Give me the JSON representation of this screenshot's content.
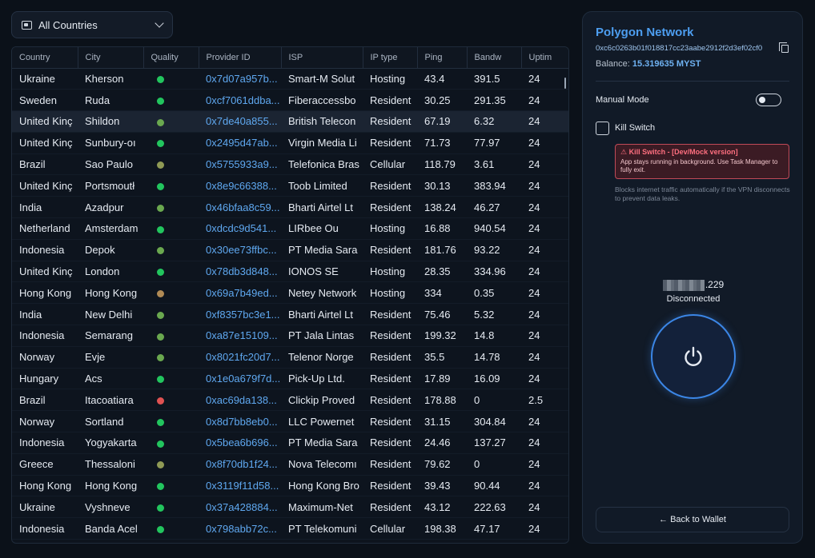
{
  "country_filter": {
    "label": "All Countries",
    "icon": "flag-icon"
  },
  "table": {
    "columns": [
      "Country",
      "City",
      "Quality",
      "Provider ID",
      "ISP",
      "IP type",
      "Ping",
      "Bandw",
      "Uptim"
    ],
    "rows": [
      {
        "country": "Ukraine",
        "city": "Kherson",
        "quality": "#22c55e",
        "provider_id": "0x7d07a957b...",
        "isp": "Smart-M Solut",
        "ip_type": "Hosting",
        "ping": "43.4",
        "bandw": "391.5",
        "uptime": "24"
      },
      {
        "country": "Sweden",
        "city": "Ruda",
        "quality": "#22c55e",
        "provider_id": "0xcf7061ddba...",
        "isp": "Fiberaccessbo",
        "ip_type": "Resident",
        "ping": "30.25",
        "bandw": "291.35",
        "uptime": "24"
      },
      {
        "country": "United Kinç",
        "city": "Shildon",
        "quality": "#6aa84f",
        "provider_id": "0x7de40a855...",
        "isp": "British Telecon",
        "ip_type": "Resident",
        "ping": "67.19",
        "bandw": "6.32",
        "uptime": "24"
      },
      {
        "country": "United Kinç",
        "city": "Sunbury-oı",
        "quality": "#22c55e",
        "provider_id": "0x2495d47ab...",
        "isp": "Virgin Media Li",
        "ip_type": "Resident",
        "ping": "71.73",
        "bandw": "77.97",
        "uptime": "24"
      },
      {
        "country": "Brazil",
        "city": "Sao Paulo",
        "quality": "#8f9a55",
        "provider_id": "0x5755933a9...",
        "isp": "Telefonica Bras",
        "ip_type": "Cellular",
        "ping": "118.79",
        "bandw": "3.61",
        "uptime": "24"
      },
      {
        "country": "United Kinç",
        "city": "Portsmoutł",
        "quality": "#22c55e",
        "provider_id": "0x8e9c66388...",
        "isp": "Toob Limited",
        "ip_type": "Resident",
        "ping": "30.13",
        "bandw": "383.94",
        "uptime": "24"
      },
      {
        "country": "India",
        "city": "Azadpur",
        "quality": "#6aa84f",
        "provider_id": "0x46bfaa8c59...",
        "isp": "Bharti Airtel Lt",
        "ip_type": "Resident",
        "ping": "138.24",
        "bandw": "46.27",
        "uptime": "24"
      },
      {
        "country": "Netherland",
        "city": "Amsterdam",
        "quality": "#22c55e",
        "provider_id": "0xdcdc9d541...",
        "isp": "LIRbee Ou",
        "ip_type": "Hosting",
        "ping": "16.88",
        "bandw": "940.54",
        "uptime": "24"
      },
      {
        "country": "Indonesia",
        "city": "Depok",
        "quality": "#6aa84f",
        "provider_id": "0x30ee73ffbc...",
        "isp": "PT Media Sara",
        "ip_type": "Resident",
        "ping": "181.76",
        "bandw": "93.22",
        "uptime": "24"
      },
      {
        "country": "United Kinç",
        "city": "London",
        "quality": "#22c55e",
        "provider_id": "0x78db3d848...",
        "isp": "IONOS SE",
        "ip_type": "Hosting",
        "ping": "28.35",
        "bandw": "334.96",
        "uptime": "24"
      },
      {
        "country": "Hong Kong",
        "city": "Hong Kong",
        "quality": "#b08a55",
        "provider_id": "0x69a7b49ed...",
        "isp": "Netey Network",
        "ip_type": "Hosting",
        "ping": "334",
        "bandw": "0.35",
        "uptime": "24"
      },
      {
        "country": "India",
        "city": "New Delhi",
        "quality": "#6aa84f",
        "provider_id": "0xf8357bc3e1...",
        "isp": "Bharti Airtel Lt",
        "ip_type": "Resident",
        "ping": "75.46",
        "bandw": "5.32",
        "uptime": "24"
      },
      {
        "country": "Indonesia",
        "city": "Semarang",
        "quality": "#6aa84f",
        "provider_id": "0xa87e15109...",
        "isp": "PT Jala Lintas",
        "ip_type": "Resident",
        "ping": "199.32",
        "bandw": "14.8",
        "uptime": "24"
      },
      {
        "country": "Norway",
        "city": "Evje",
        "quality": "#6aa84f",
        "provider_id": "0x8021fc20d7...",
        "isp": "Telenor Norge",
        "ip_type": "Resident",
        "ping": "35.5",
        "bandw": "14.78",
        "uptime": "24"
      },
      {
        "country": "Hungary",
        "city": "Acs",
        "quality": "#22c55e",
        "provider_id": "0x1e0a679f7d...",
        "isp": "Pick-Up Ltd.",
        "ip_type": "Resident",
        "ping": "17.89",
        "bandw": "16.09",
        "uptime": "24"
      },
      {
        "country": "Brazil",
        "city": "Itacoatiara",
        "quality": "#e05252",
        "provider_id": "0xac69da138...",
        "isp": "Clickip Proved",
        "ip_type": "Resident",
        "ping": "178.88",
        "bandw": "0",
        "uptime": "2.5"
      },
      {
        "country": "Norway",
        "city": "Sortland",
        "quality": "#22c55e",
        "provider_id": "0x8d7bb8eb0...",
        "isp": "LLC Powernet",
        "ip_type": "Resident",
        "ping": "31.15",
        "bandw": "304.84",
        "uptime": "24"
      },
      {
        "country": "Indonesia",
        "city": "Yogyakarta",
        "quality": "#22c55e",
        "provider_id": "0x5bea6b696...",
        "isp": "PT Media Sara",
        "ip_type": "Resident",
        "ping": "24.46",
        "bandw": "137.27",
        "uptime": "24"
      },
      {
        "country": "Greece",
        "city": "Thessaloni",
        "quality": "#8f9a55",
        "provider_id": "0x8f70db1f24...",
        "isp": "Nova Telecomı",
        "ip_type": "Resident",
        "ping": "79.62",
        "bandw": "0",
        "uptime": "24"
      },
      {
        "country": "Hong Kong",
        "city": "Hong Kong",
        "quality": "#22c55e",
        "provider_id": "0x3119f11d58...",
        "isp": "Hong Kong Bro",
        "ip_type": "Resident",
        "ping": "39.43",
        "bandw": "90.44",
        "uptime": "24"
      },
      {
        "country": "Ukraine",
        "city": "Vyshneve",
        "quality": "#22c55e",
        "provider_id": "0x37a428884...",
        "isp": "Maximum-Net",
        "ip_type": "Resident",
        "ping": "43.12",
        "bandw": "222.63",
        "uptime": "24"
      },
      {
        "country": "Indonesia",
        "city": "Banda Acel",
        "quality": "#22c55e",
        "provider_id": "0x798abb72c...",
        "isp": "PT Telekomuni",
        "ip_type": "Cellular",
        "ping": "198.38",
        "bandw": "47.17",
        "uptime": "24"
      }
    ],
    "selected_row": 2
  },
  "panel": {
    "network_title": "Polygon Network",
    "address": "0xc6c0263b01f018817cc23aabe2912f2d3ef02cf0",
    "balance_label": "Balance:",
    "balance_value": "15.319635 MYST",
    "manual_mode_label": "Manual Mode",
    "kill_switch_label": "Kill Switch",
    "kill_warning_title": "Kill Switch - [Dev/Mock version]",
    "kill_warning_text": "App stays running in background. Use Task Manager to fully exit.",
    "kill_description": "Blocks internet traffic automatically if the VPN disconnects to prevent data leaks.",
    "ip_suffix": ".229",
    "status": "Disconnected",
    "back_button": "← Back to Wallet"
  }
}
